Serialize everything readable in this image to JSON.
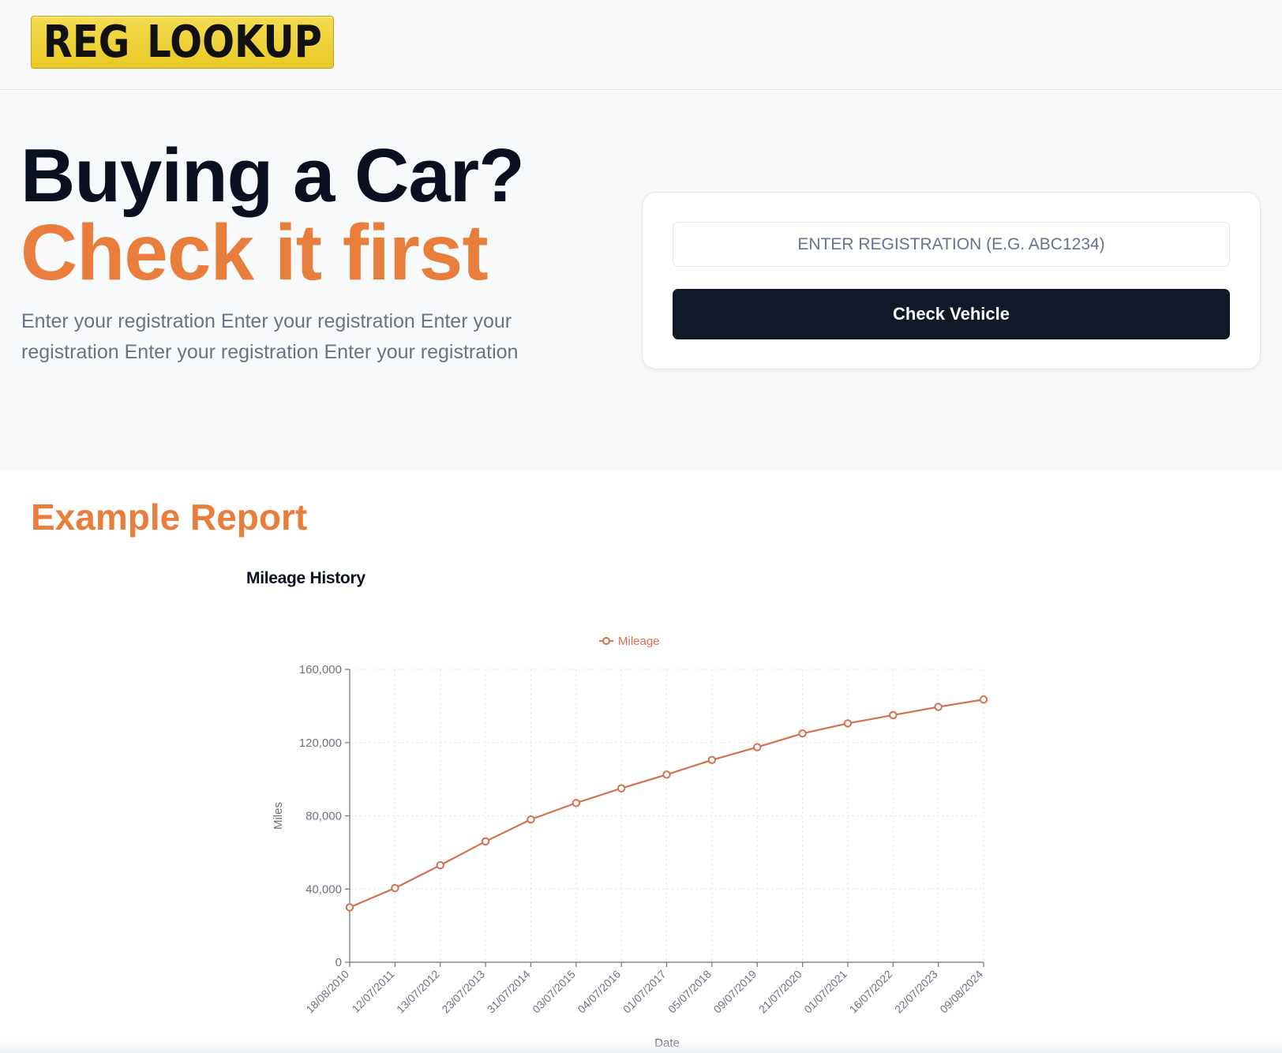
{
  "brand": {
    "logo_text": "REG LOOKUP"
  },
  "hero": {
    "headline_primary": "Buying a Car?",
    "headline_accent": "Check it first",
    "subtext": "Enter your registration Enter your registration Enter your registration Enter your registration Enter your registration"
  },
  "search": {
    "placeholder": "ENTER REGISTRATION (E.G. ABC1234)",
    "value": "",
    "button_label": "Check Vehicle"
  },
  "report": {
    "title": "Example Report",
    "chart_title": "Mileage History"
  },
  "colors": {
    "accent": "#e97e3c",
    "dark": "#111827",
    "line": "#d4704f",
    "plate_yellow": "#f0d33b"
  },
  "chart_data": {
    "type": "line",
    "title": "Mileage History",
    "xlabel": "Date",
    "ylabel": "Miles",
    "ylim": [
      0,
      160000
    ],
    "yticks": [
      "0",
      "40,000",
      "80,000",
      "120,000",
      "160,000"
    ],
    "ytick_values": [
      0,
      40000,
      80000,
      120000,
      160000
    ],
    "grid": true,
    "legend": "top-center",
    "x": [
      "18/08/2010",
      "12/07/2011",
      "13/07/2012",
      "23/07/2013",
      "31/07/2014",
      "03/07/2015",
      "04/07/2016",
      "01/07/2017",
      "05/07/2018",
      "09/07/2019",
      "21/07/2020",
      "01/07/2021",
      "16/07/2022",
      "22/07/2023",
      "09/08/2024"
    ],
    "series": [
      {
        "name": "Mileage",
        "values": [
          30000,
          40500,
          53000,
          66000,
          78000,
          87000,
          95000,
          102500,
          110500,
          117500,
          125000,
          130500,
          135000,
          139500,
          143500
        ]
      }
    ]
  }
}
